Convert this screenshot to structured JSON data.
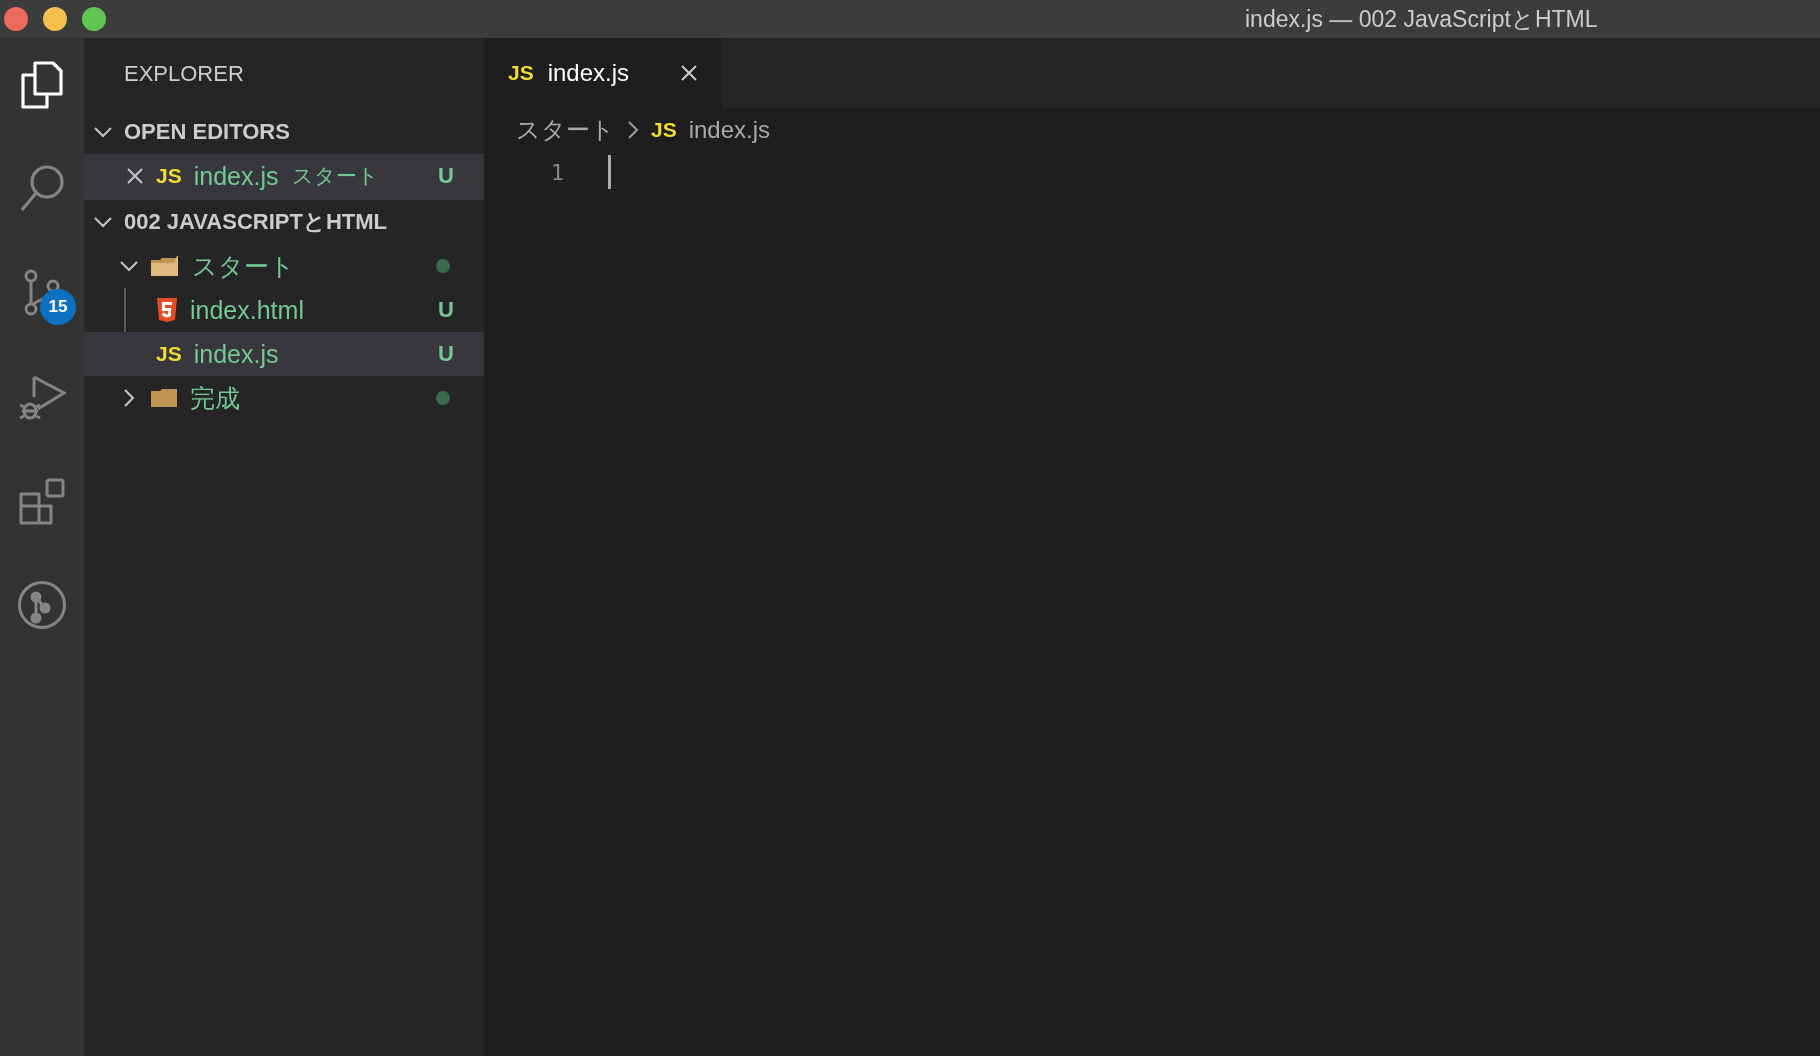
{
  "window": {
    "title": "index.js — 002 JavaScriptとHTML"
  },
  "activity_bar": [
    {
      "kind": "explorer",
      "selected": true
    },
    {
      "kind": "search",
      "selected": false
    },
    {
      "kind": "source-control",
      "selected": false,
      "badge": "15"
    },
    {
      "kind": "run",
      "selected": false
    },
    {
      "kind": "extensions",
      "selected": false
    },
    {
      "kind": "git-graph",
      "selected": false
    }
  ],
  "sidebar": {
    "title": "EXPLORER",
    "open_editors": {
      "title": "OPEN EDITORS",
      "expanded": true,
      "items": [
        {
          "name": "index.js",
          "icon": "JS",
          "folder": "スタート",
          "status": "U",
          "selected": true
        }
      ]
    },
    "project": {
      "title": "002 JAVASCRIPTとHTML",
      "expanded": true,
      "tree": [
        {
          "name": "スタート",
          "kind": "folder",
          "expanded": true,
          "modified": true,
          "selected": false,
          "children": [
            {
              "name": "index.html",
              "kind": "html",
              "status": "U",
              "selected": false
            },
            {
              "name": "index.js",
              "kind": "js",
              "icon": "JS",
              "status": "U",
              "selected": true
            }
          ]
        },
        {
          "name": "完成",
          "kind": "folder",
          "expanded": false,
          "modified": true,
          "selected": false
        }
      ]
    }
  },
  "tabs": [
    {
      "label": "index.js",
      "icon": "JS",
      "selected": true
    }
  ],
  "breadcrumbs": [
    {
      "label": "スタート",
      "kind": "folder"
    },
    {
      "label": "index.js",
      "kind": "js",
      "icon": "JS"
    }
  ],
  "editor": {
    "lines": [
      {
        "number": "1",
        "cursor": true
      }
    ]
  }
}
